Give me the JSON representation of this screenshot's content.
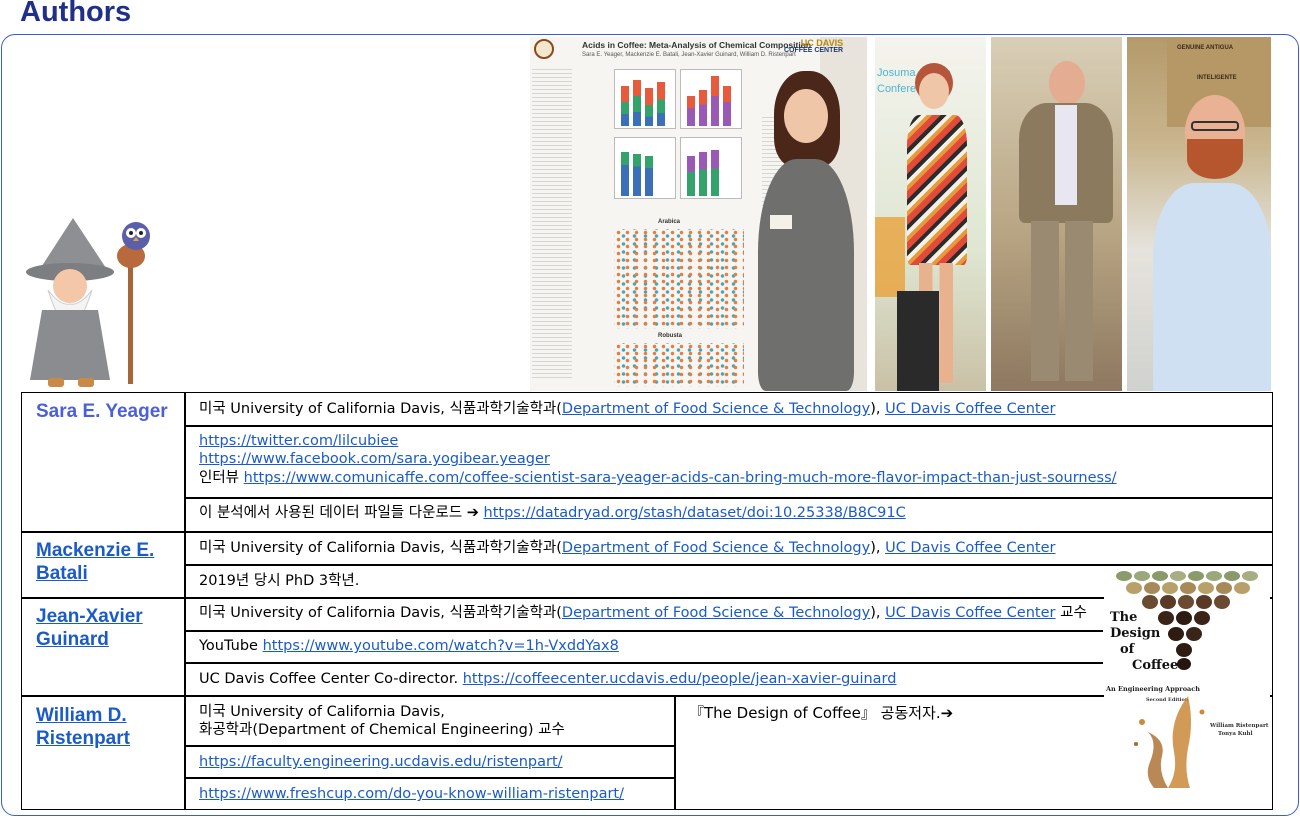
{
  "heading": "Authors",
  "poster": {
    "title": "Acids in Coffee: Meta-Analysis of Chemical Composition",
    "authors": "Sara E. Yeager, Mackenzie E. Batali, Jean-Xavier Guinard, William D. Ristenpart",
    "logo_line1": "UC DAVIS",
    "logo_line2": "COFFEE CENTER",
    "section_arabica": "Arabica",
    "section_robusta": "Robusta"
  },
  "photo_conference": {
    "banner_line1": "Josuma Coffee",
    "banner_line2": "Conference"
  },
  "photo_sacks": {
    "sack_text1": "GENUINE ANTIGUA",
    "sack_text2": "INTELIGENTE"
  },
  "authors": [
    {
      "name": "Sara E. Yeager",
      "affiliation_prefix": "미국 University of California Davis, 식품과학기술학과(",
      "department_link": "Department of Food Science & Technology",
      "affiliation_mid": "), ",
      "center_link": "UC Davis Coffee Center",
      "links": [
        "https://twitter.com/lilcubiee",
        "https://www.facebook.com/sara.yogibear.yeager"
      ],
      "interview_label": "인터뷰",
      "interview_link": "https://www.comunicaffe.com/coffee-scientist-sara-yeager-acids-can-bring-much-more-flavor-impact-than-just-sourness/",
      "data_label": "이 분석에서 사용된 데이터 파일들 다운로드 ➔",
      "data_link": "https://datadryad.org/stash/dataset/doi:10.25338/B8C91C"
    },
    {
      "name_line1": "Mackenzie E.",
      "name_line2": "Batali",
      "affiliation_prefix": "미국 University of California Davis, 식품과학기술학과(",
      "department_link": "Department of Food Science & Technology",
      "affiliation_mid": "), ",
      "center_link": "UC Davis Coffee Center",
      "note": "2019년 당시 PhD 3학년."
    },
    {
      "name_line1": "Jean-Xavier",
      "name_line2": "Guinard",
      "affiliation_prefix": "미국 University of California Davis, 식품과학기술학과(",
      "department_link": "Department of Food Science & Technology",
      "affiliation_mid": "), ",
      "center_link": "UC Davis Coffee Center",
      "affiliation_suffix": " 교수",
      "youtube_label": "YouTube",
      "youtube_link": "https://www.youtube.com/watch?v=1h-VxddYax8",
      "codirector_label": "UC Davis Coffee Center Co-director.",
      "codirector_link": "https://coffeecenter.ucdavis.edu/people/jean-xavier-guinard"
    },
    {
      "name_line1": "William D.",
      "name_line2": "Ristenpart",
      "affiliation_line1": "미국 University of California Davis,",
      "affiliation_line2": "화공학과(Department of Chemical Engineering) 교수",
      "link1": "https://faculty.engineering.ucdavis.edu/ristenpart/",
      "link2": "https://www.freshcup.com/do-you-know-william-ristenpart/",
      "book_note": "『The Design of Coffee』 공동저자.➔"
    }
  ],
  "book": {
    "title_line1": "The",
    "title_line2": "Design",
    "title_line3": "of",
    "title_line4": "Coffee",
    "subtitle": "An Engineering Approach",
    "edition": "Second Edition",
    "author1": "William Ristenpart",
    "author2": "Tonya Kuhl"
  }
}
